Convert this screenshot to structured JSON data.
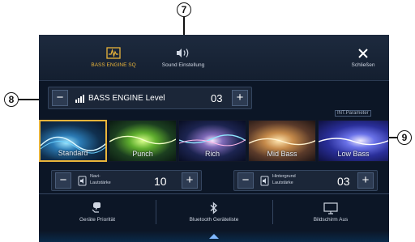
{
  "top_tabs": [
    {
      "label": "BASS ENGINE SQ",
      "icon": "bass-engine-icon"
    },
    {
      "label": "Sound Einstellung",
      "icon": "speaker-icon"
    },
    {
      "label": "Schließen",
      "icon": "close-icon"
    }
  ],
  "bass_engine": {
    "label": "BASS ENGINE Level",
    "value": "03",
    "minus": "−",
    "plus": "+"
  },
  "int_parameter": "INT.Parameter",
  "presets": [
    {
      "label": "Standard",
      "selected": true
    },
    {
      "label": "Punch",
      "selected": false
    },
    {
      "label": "Rich",
      "selected": false
    },
    {
      "label": "Mid Bass",
      "selected": false
    },
    {
      "label": "Low Bass",
      "selected": false
    }
  ],
  "navi_volume": {
    "line1": "Navi-",
    "line2": "Lautstärke",
    "value": "10",
    "minus": "−",
    "plus": "+"
  },
  "background_volume": {
    "line1": "Hintergrund",
    "line2": "Lautstärke",
    "value": "03",
    "minus": "−",
    "plus": "+"
  },
  "bottom_menu": [
    {
      "label": "Geräte Priorität",
      "icon": "device-priority-icon"
    },
    {
      "label": "Bluetooth Geräteliste",
      "icon": "bluetooth-icon"
    },
    {
      "label": "Bildschirm Aus",
      "icon": "monitor-icon"
    }
  ],
  "callouts": {
    "seven": "7",
    "eight": "8",
    "nine": "9"
  },
  "colors": {
    "accent": "#e9b43a",
    "selected_border": "#e9b43a",
    "screen_bg": "#0c1626"
  }
}
